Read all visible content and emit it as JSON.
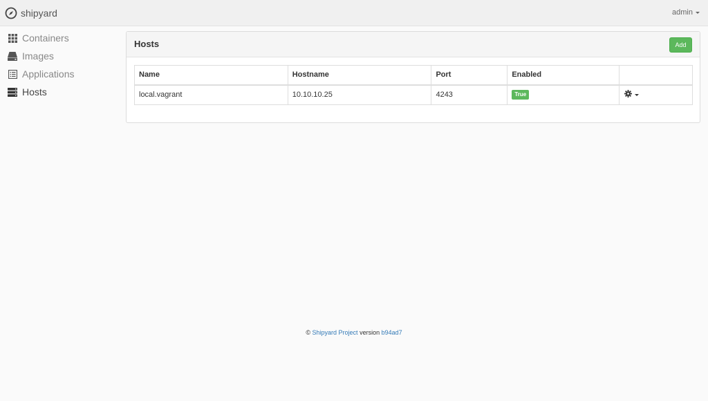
{
  "navbar": {
    "brand": "shipyard",
    "user": "admin"
  },
  "sidebar": {
    "items": [
      {
        "label": "Containers",
        "icon": "grid-icon"
      },
      {
        "label": "Images",
        "icon": "hdd-icon"
      },
      {
        "label": "Applications",
        "icon": "list-alt-icon"
      },
      {
        "label": "Hosts",
        "icon": "server-icon",
        "active": true
      }
    ]
  },
  "panel": {
    "title": "Hosts",
    "add_label": "Add",
    "columns": [
      "Name",
      "Hostname",
      "Port",
      "Enabled",
      ""
    ],
    "rows": [
      {
        "name": "local.vagrant",
        "hostname": "10.10.10.25",
        "port": "4243",
        "enabled": "True"
      }
    ]
  },
  "footer": {
    "copyright": "©",
    "project_link": "Shipyard Project",
    "version_text": "version",
    "version_link": "b94ad7"
  },
  "colors": {
    "success": "#5cb85c",
    "link": "#337ab7",
    "navbar_bg": "#f0f0f0",
    "page_bg": "#fafafa"
  }
}
